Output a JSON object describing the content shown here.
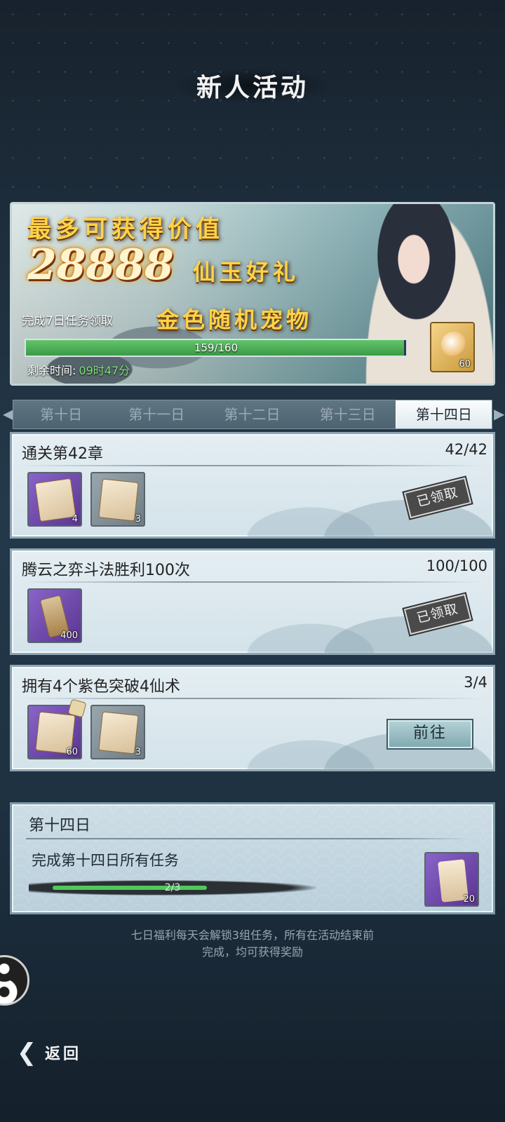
{
  "header": {
    "title": "新人活动"
  },
  "banner": {
    "line1": "最多可获得价值",
    "amount": "28888",
    "amount_suffix": "仙玉好礼",
    "task_text": "完成7日任务领取",
    "gold_text": "金色随机宠物",
    "progress": {
      "text": "159/160",
      "fraction": 0.99375
    },
    "time_label": "剩余时间:",
    "time_value": "09时47分",
    "reward_count": "60"
  },
  "tabs": [
    {
      "label": "第十日"
    },
    {
      "label": "第十一日"
    },
    {
      "label": "第十二日"
    },
    {
      "label": "第十三日"
    },
    {
      "label": "第十四日",
      "active": true
    }
  ],
  "tasks": [
    {
      "title": "通关第42章",
      "count": "42/42",
      "rewards": [
        "4",
        "3"
      ],
      "status": "已领取"
    },
    {
      "title": "腾云之弈斗法胜利100次",
      "count": "100/100",
      "rewards": [
        "400"
      ],
      "status": "已领取"
    },
    {
      "title": "拥有4个紫色突破4仙术",
      "count": "3/4",
      "rewards": [
        "60",
        "3"
      ],
      "action": "前往"
    }
  ],
  "day_summary": {
    "title": "第十四日",
    "description": "完成第十四日所有任务",
    "progress": {
      "text": "2/3",
      "fraction": 0.6667
    },
    "reward_count": "20"
  },
  "footer": {
    "note_line1": "七日福利每天会解锁3组任务，所有在活动结束前",
    "note_line2": "完成，均可获得奖励"
  },
  "back_button": {
    "label": "返回"
  },
  "colors": {
    "progress_green": "#4fc95a",
    "time_green": "#7ce17a",
    "gold_text": "#ffd24a"
  }
}
